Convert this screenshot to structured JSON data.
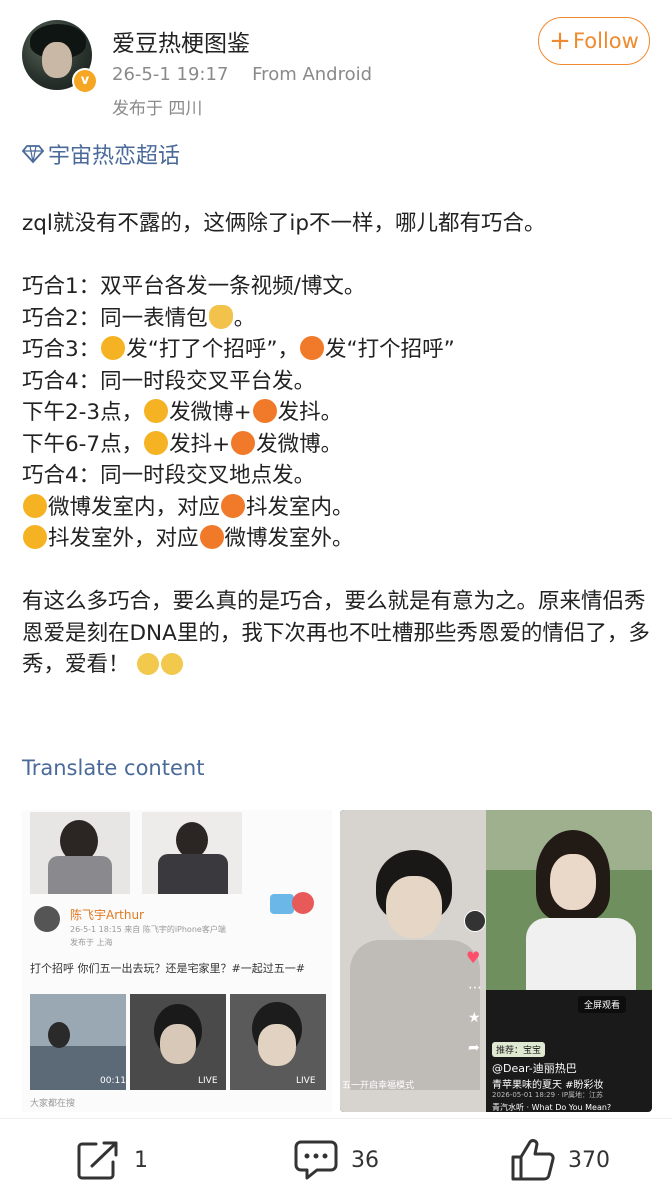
{
  "header": {
    "username": "爱豆热梗图鉴",
    "time": "26-5-1 19:17",
    "source": "From Android",
    "location": "发布于 四川",
    "follow_label": "Follow"
  },
  "topic": {
    "label": "宇宙热恋超话"
  },
  "post": {
    "line1": "zql就没有不露的，这俩除了ip不一样，哪儿都有巧合。",
    "c1": "巧合1：双平台各发一条视频/博文。",
    "c2a": "巧合2：同一表情包",
    "c2b": "。",
    "c3a": "巧合3：",
    "c3b": "发“打了个招呼”，",
    "c3c": "发“打个招呼”",
    "c4": "巧合4：同一时段交叉平台发。",
    "c5a": "下午2-3点，",
    "c5b": "发微博+",
    "c5c": "发抖。",
    "c6a": "下午6-7点，",
    "c6b": "发抖+",
    "c6c": "发微博。",
    "c7": "巧合4：同一时段交叉地点发。",
    "c8a": "微博发室内，对应",
    "c8b": "抖发室内。",
    "c9a": "抖发室外，对应",
    "c9b": "微博发室外。",
    "para2a": "有这么多巧合，要么真的是巧合，要么就是有意为之。原来情侣秀恩爱是刻在DNA里的，我下次再也不吐槽那些秀恩爱的情侣了，多秀，爱看！"
  },
  "translate_label": "Translate content",
  "embedded": {
    "left_user": "陈飞宇Arthur",
    "left_meta": "26-5-1 18:15  来自 陈飞宇的iPhone客户端",
    "left_loc": "发布于 上海",
    "left_text": "打个招呼 你们五一出去玩？还是宅家里？#一起过五一#",
    "left_dur": "00:11",
    "left_live1": "LIVE",
    "left_live2": "LIVE",
    "left_footer": "大家都在搜",
    "right_tag": "推荐：宝宝",
    "right_fullscreen": "全屏观看",
    "right_user": "@Dear-迪丽热巴",
    "right_text": "青苹果味的夏天 #盼彩妆",
    "right_meta": "2026-05-01 18:29 · IP属地：江苏",
    "right_music": "青汽水听 · What Do You Mean?",
    "right_bottom": "五一开启幸福模式"
  },
  "actions": {
    "share_count": "1",
    "comment_count": "36",
    "like_count": "370"
  }
}
